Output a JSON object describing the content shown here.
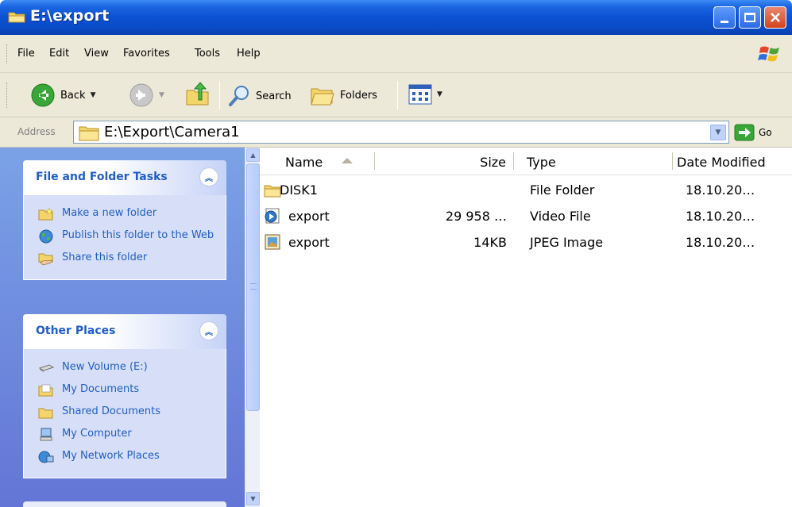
{
  "window": {
    "title": "E:\\export"
  },
  "menubar": {
    "items": [
      "File",
      "Edit",
      "View",
      "Favorites",
      "Tools",
      "Help"
    ]
  },
  "toolbar": {
    "back_label": "Back",
    "search_label": "Search",
    "folders_label": "Folders"
  },
  "address": {
    "label": "Address",
    "value": "E:\\Export\\Camera1",
    "go_label": "Go"
  },
  "tasks": {
    "file_folder": {
      "title": "File and Folder Tasks",
      "items": [
        "Make a new folder",
        "Publish this folder to the Web",
        "Share this folder"
      ]
    },
    "other_places": {
      "title": "Other Places",
      "items": [
        "New Volume (E:)",
        "My Documents",
        "Shared Documents",
        "My Computer",
        "My Network Places"
      ]
    }
  },
  "filelist": {
    "columns": [
      "Name",
      "Size",
      "Type",
      "Date Modified"
    ],
    "sort_column": "Name",
    "rows": [
      {
        "icon": "folder-icon",
        "name": "DISK1",
        "size": "",
        "type": "File Folder",
        "date": "18.10.20…"
      },
      {
        "icon": "video-file-icon",
        "name": "export",
        "size": "29 958 …",
        "type": "Video File",
        "date": "18.10.20…"
      },
      {
        "icon": "jpeg-file-icon",
        "name": "export",
        "size": "14KB",
        "type": "JPEG Image",
        "date": "18.10.20…"
      }
    ]
  },
  "colors": {
    "titlebar": "#0b52d4",
    "taskpane": "#6f8ede",
    "link": "#215dc6",
    "chrome": "#ece9d8"
  }
}
